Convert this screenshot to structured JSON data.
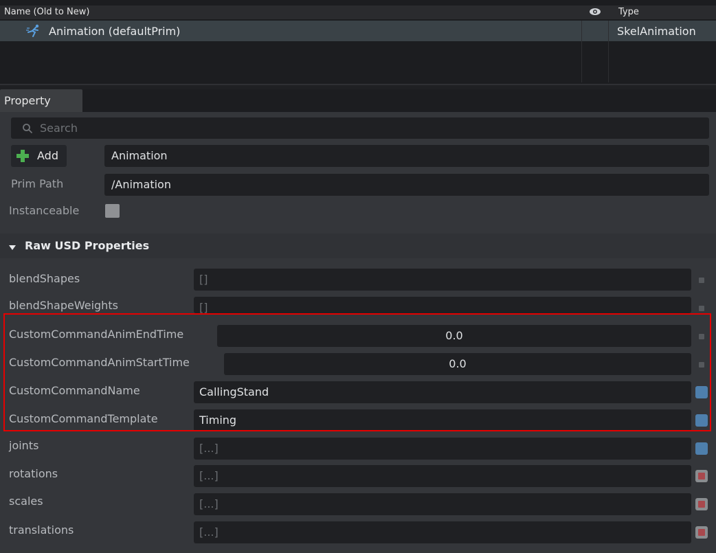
{
  "stage": {
    "header": {
      "name_col": "Name (Old to New)",
      "eye_icon": "eye-icon",
      "type_col": "Type"
    },
    "row": {
      "icon": "skel-animation-icon",
      "name": "Animation (defaultPrim)",
      "type": "SkelAnimation"
    }
  },
  "property_panel": {
    "tab": "Property",
    "search_placeholder": "Search",
    "add_label": "Add",
    "prim_name_value": "Animation",
    "prim_path_label": "Prim Path",
    "prim_path_value": "/Animation",
    "instanceable_label": "Instanceable",
    "section_title": "Raw USD Properties",
    "properties": [
      {
        "name": "blendShapes",
        "value": "[]"
      },
      {
        "name": "blendShapeWeights",
        "value": "[]"
      },
      {
        "name": "CustomCommandAnimEndTime",
        "value": "0.0"
      },
      {
        "name": "CustomCommandAnimStartTime",
        "value": "0.0"
      },
      {
        "name": "CustomCommandName",
        "value": "CallingStand"
      },
      {
        "name": "CustomCommandTemplate",
        "value": "Timing"
      },
      {
        "name": "joints",
        "value": "[...]"
      },
      {
        "name": "rotations",
        "value": "[...]"
      },
      {
        "name": "scales",
        "value": "[...]"
      },
      {
        "name": "translations",
        "value": "[...]"
      }
    ]
  },
  "colors": {
    "highlight": "#e60000",
    "selected_row": "#3a4247",
    "blue_badge": "#4e7fac",
    "red_badge": "#a8484d"
  }
}
